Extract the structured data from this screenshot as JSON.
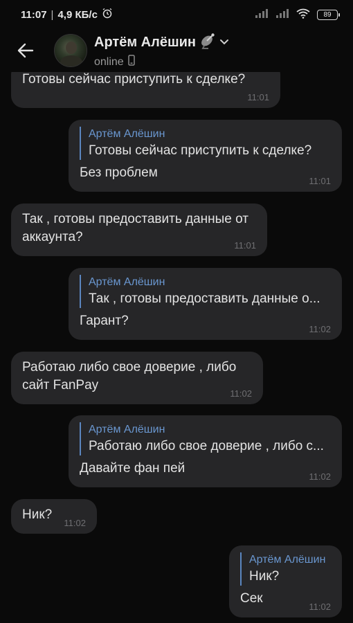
{
  "status_bar": {
    "time": "11:07",
    "net_speed": "4,9 КБ/с",
    "battery": "89"
  },
  "header": {
    "title": "Артём Алёшин",
    "status": "online"
  },
  "messages": [
    {
      "id": 1,
      "side": "in",
      "text": "Готовы сейчас приступить к сделке?",
      "time": "11:01"
    },
    {
      "id": 2,
      "side": "out",
      "reply_name": "Артём Алёшин",
      "reply_text": "Готовы сейчас приступить к сделке?",
      "text": "Без проблем",
      "time": "11:01"
    },
    {
      "id": 3,
      "side": "in",
      "text": "Так , готовы предоставить данные от аккаунта?",
      "time": "11:01"
    },
    {
      "id": 4,
      "side": "out",
      "reply_name": "Артём Алёшин",
      "reply_text": "Так , готовы предоставить данные о...",
      "text": "Гарант?",
      "time": "11:02"
    },
    {
      "id": 5,
      "side": "in",
      "text": "Работаю либо свое доверие , либо сайт FanPay",
      "time": "11:02"
    },
    {
      "id": 6,
      "side": "out",
      "reply_name": "Артём Алёшин",
      "reply_text": "Работаю либо свое доверие , либо с...",
      "text": "Давайте фан пей",
      "time": "11:02"
    },
    {
      "id": 7,
      "side": "in",
      "text": "Ник?",
      "time": "11:02"
    },
    {
      "id": 8,
      "side": "out",
      "reply_name": "Артём Алёшин",
      "reply_text": "Ник?",
      "text": "Сек",
      "time": "11:02"
    }
  ],
  "colors": {
    "background": "#0a0a0a",
    "bubble": "#262628",
    "accent": "#6a97d0",
    "time": "#6f6f72"
  }
}
